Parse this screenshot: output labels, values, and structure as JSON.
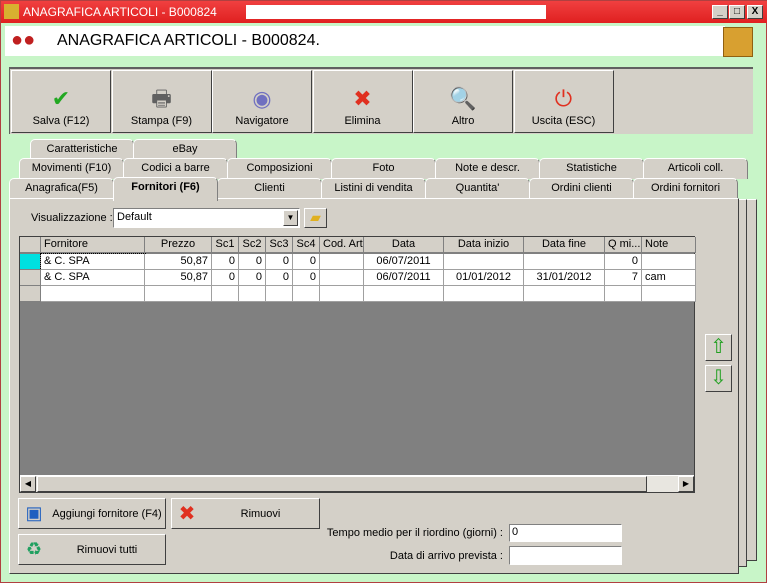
{
  "window": {
    "title": "ANAGRAFICA ARTICOLI - B000824",
    "minimize": "_",
    "maximize": "□",
    "close": "X"
  },
  "header": {
    "title": "ANAGRAFICA ARTICOLI - B000824."
  },
  "toolbar": [
    {
      "label": "Salva (F12)",
      "icon": "check-icon",
      "glyph": "✔",
      "color": "#22a822"
    },
    {
      "label": "Stampa (F9)",
      "icon": "printer-icon",
      "glyph": "🖶",
      "color": "#606060"
    },
    {
      "label": "Navigatore",
      "icon": "compass-icon",
      "glyph": "◉",
      "color": "#7070c0"
    },
    {
      "label": "Elimina",
      "icon": "delete-x-icon",
      "glyph": "✖",
      "color": "#e03020"
    },
    {
      "label": "Altro",
      "icon": "magnifier-icon",
      "glyph": "🔍",
      "color": "#2060c0"
    },
    {
      "label": "Uscita (ESC)",
      "icon": "power-icon",
      "glyph": "⏻",
      "color": "#e03020"
    }
  ],
  "tabs": {
    "row1": [
      "Caratteristiche",
      "eBay"
    ],
    "row2": [
      "Movimenti (F10)",
      "Codici a barre",
      "Composizioni",
      "Foto",
      "Note e descr.",
      "Statistiche",
      "Articoli coll."
    ],
    "row3": [
      "Anagrafica(F5)",
      "Fornitori (F6)",
      "Clienti",
      "Listini di vendita",
      "Quantita'",
      "Ordini clienti",
      "Ordini fornitori"
    ],
    "selected": "Fornitori (F6)"
  },
  "view": {
    "label": "Visualizzazione :",
    "value": "Default"
  },
  "grid": {
    "columns": [
      "Fornitore",
      "Prezzo",
      "Sc1",
      "Sc2",
      "Sc3",
      "Sc4",
      "Cod. Art",
      "Data",
      "Data inizio",
      "Data fine",
      "Q mi...",
      "Note"
    ],
    "rows": [
      [
        "& C. SPA",
        "50,87",
        "0",
        "0",
        "0",
        "0",
        "",
        "06/07/2011",
        "",
        "",
        "0",
        ""
      ],
      [
        "& C. SPA",
        "50,87",
        "0",
        "0",
        "0",
        "0",
        "",
        "06/07/2011",
        "01/01/2012",
        "31/01/2012",
        "7",
        "cam"
      ]
    ]
  },
  "buttons": {
    "add": "Aggiungi fornitore (F4)",
    "remove": "Rimuovi",
    "remove_all": "Rimuovi tutti"
  },
  "fields": {
    "reorder_label": "Tempo medio per il riordino (giorni) :",
    "reorder_value": "0",
    "arrival_label": "Data di arrivo prevista :",
    "arrival_value": ""
  }
}
